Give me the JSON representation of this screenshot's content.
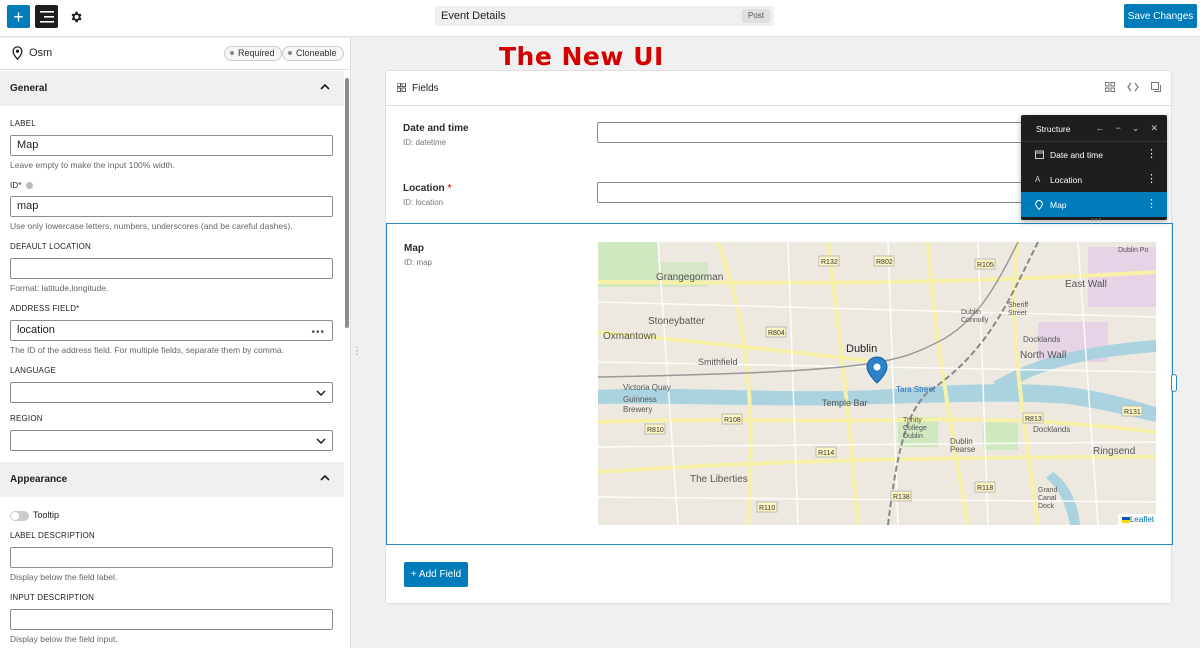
{
  "topbar": {
    "document_title": "Event Details",
    "document_type": "Post",
    "save_label": "Save Changes"
  },
  "sidebar": {
    "field_name": "Osm",
    "badges": [
      "Required",
      "Cloneable"
    ],
    "general": {
      "title": "General",
      "label_field": {
        "label": "LABEL",
        "value": "Map",
        "help": "Leave empty to make the input 100% width."
      },
      "id_field": {
        "label": "ID*",
        "value": "map",
        "help": "Use only lowercase letters, numbers, underscores (and be careful dashes)."
      },
      "default_location": {
        "label": "DEFAULT LOCATION",
        "value": "",
        "help": "Format: latitude,longitude."
      },
      "address_field": {
        "label": "ADDRESS FIELD*",
        "value": "location",
        "help": "The ID of the address field. For multiple fields, separate them by comma."
      },
      "language": {
        "label": "LANGUAGE",
        "value": ""
      },
      "region": {
        "label": "REGION",
        "value": ""
      }
    },
    "appearance": {
      "title": "Appearance",
      "tooltip_label": "Tooltip",
      "label_description": {
        "label": "LABEL DESCRIPTION",
        "value": "",
        "help": "Display below the field label."
      },
      "input_description": {
        "label": "INPUT DESCRIPTION",
        "value": "",
        "help": "Display below the field input."
      }
    }
  },
  "main": {
    "banner": "The New UI",
    "panel_title": "Fields",
    "fields": [
      {
        "label": "Date and time",
        "id": "ID: datetime",
        "required": false
      },
      {
        "label": "Location",
        "id": "ID: location",
        "required": true
      },
      {
        "label": "Map",
        "id": "ID: map",
        "required": false
      }
    ],
    "add_field_label": "+ Add Field",
    "map": {
      "city": "Dublin",
      "attribution": "Leaflet",
      "labels": [
        "Grangegorman",
        "Stoneybatter",
        "Oxmantown",
        "Smithfield",
        "Dublin",
        "Temple Bar",
        "Victoria Quay",
        "Guinness Brewery",
        "The Liberties",
        "Trinity College Dublin",
        "Tara Street",
        "Dublin Pearse",
        "North Wall",
        "East Wall",
        "Docklands",
        "Ringsend",
        "Grand Canal Dock",
        "Dublin Connolly",
        "Sheriff Street",
        "Dublin Port",
        "R132",
        "R802",
        "R105",
        "R804",
        "R108",
        "R810",
        "R114",
        "R138",
        "R110",
        "R118",
        "R813",
        "R131"
      ]
    }
  },
  "structure": {
    "title": "Structure",
    "items": [
      {
        "label": "Date and time",
        "icon": "calendar-icon"
      },
      {
        "label": "Location",
        "icon": "text-icon"
      },
      {
        "label": "Map",
        "icon": "map-pin-icon"
      }
    ]
  },
  "colors": {
    "accent": "#007cba",
    "banner": "#d40000",
    "structure_bg": "#1e1e1e"
  }
}
